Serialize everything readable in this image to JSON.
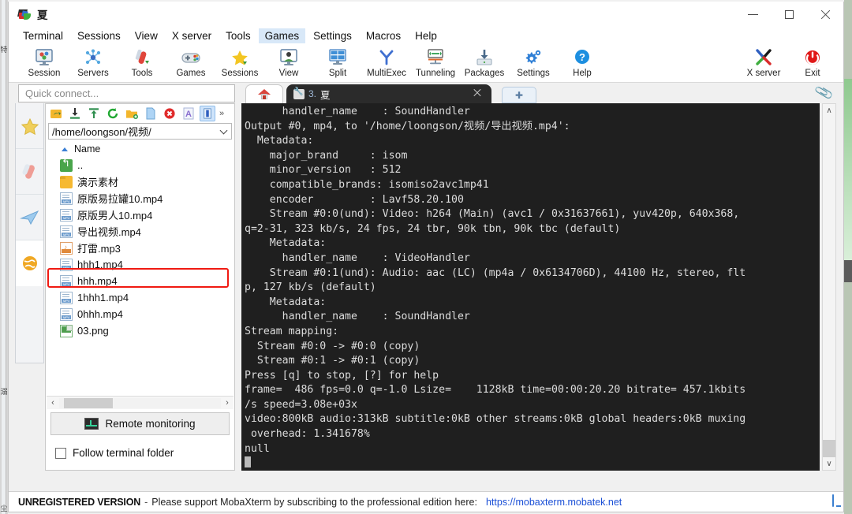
{
  "window": {
    "title": "夏",
    "app_icon": "mobaxterm-logo-icon",
    "minimize_label": "Minimize",
    "maximize_label": "Maximize",
    "close_label": "Close"
  },
  "menubar": {
    "items": [
      {
        "label": "Terminal",
        "active": false
      },
      {
        "label": "Sessions",
        "active": false
      },
      {
        "label": "View",
        "active": false
      },
      {
        "label": "X server",
        "active": false
      },
      {
        "label": "Tools",
        "active": false
      },
      {
        "label": "Games",
        "active": true
      },
      {
        "label": "Settings",
        "active": false
      },
      {
        "label": "Macros",
        "active": false
      },
      {
        "label": "Help",
        "active": false
      }
    ]
  },
  "toolbar": {
    "items": [
      {
        "label": "Session",
        "icon": "session-icon"
      },
      {
        "label": "Servers",
        "icon": "servers-icon"
      },
      {
        "label": "Tools",
        "icon": "tools-icon"
      },
      {
        "label": "Games",
        "icon": "games-gamepad-icon"
      },
      {
        "label": "Sessions",
        "icon": "star-icon"
      },
      {
        "label": "View",
        "icon": "view-monitor-icon"
      },
      {
        "label": "Split",
        "icon": "split-icon"
      },
      {
        "label": "MultiExec",
        "icon": "multiexec-icon"
      },
      {
        "label": "Tunneling",
        "icon": "tunneling-icon"
      },
      {
        "label": "Packages",
        "icon": "packages-download-icon"
      },
      {
        "label": "Settings",
        "icon": "gear-icon"
      },
      {
        "label": "Help",
        "icon": "help-question-icon"
      }
    ],
    "right_items": [
      {
        "label": "X server",
        "icon": "x-server-icon"
      },
      {
        "label": "Exit",
        "icon": "power-exit-icon"
      }
    ]
  },
  "quick_connect": {
    "placeholder": "Quick connect..."
  },
  "rail": {
    "items": [
      {
        "name": "sessions-star",
        "icon": "star-icon"
      },
      {
        "name": "tools",
        "icon": "swiss-knife-icon"
      },
      {
        "name": "macros",
        "icon": "paper-plane-icon"
      },
      {
        "name": "globe",
        "icon": "globe-icon"
      }
    ]
  },
  "file_browser": {
    "toolbar_icons": [
      {
        "name": "go-up-icon",
        "selected": false
      },
      {
        "name": "download-icon",
        "selected": false
      },
      {
        "name": "upload-icon",
        "selected": false
      },
      {
        "name": "refresh-icon",
        "selected": false
      },
      {
        "name": "new-folder-icon",
        "selected": false
      },
      {
        "name": "new-file-icon",
        "selected": false
      },
      {
        "name": "delete-icon",
        "selected": false
      },
      {
        "name": "text-mode-icon",
        "selected": false
      },
      {
        "name": "binary-mode-icon",
        "selected": true
      }
    ],
    "more_label": "»",
    "path": "/home/loongson/视频/",
    "column_header": "Name",
    "rows": [
      {
        "name": "..",
        "icon": "parent-dir-icon",
        "highlighted": false
      },
      {
        "name": "演示素材",
        "icon": "folder-icon",
        "highlighted": false
      },
      {
        "name": "原版易拉罐10.mp4",
        "icon": "mp4-file-icon",
        "highlighted": false
      },
      {
        "name": "原版男人10.mp4",
        "icon": "mp4-file-icon",
        "highlighted": false
      },
      {
        "name": "导出视频.mp4",
        "icon": "mp4-file-icon",
        "highlighted": true
      },
      {
        "name": "打雷.mp3",
        "icon": "mp3-file-icon",
        "highlighted": false
      },
      {
        "name": "hhh1.mp4",
        "icon": "mp4-file-icon",
        "highlighted": false
      },
      {
        "name": "hhh.mp4",
        "icon": "mp4-file-icon",
        "highlighted": false
      },
      {
        "name": "1hhh1.mp4",
        "icon": "mp4-file-icon",
        "highlighted": false
      },
      {
        "name": "0hhh.mp4",
        "icon": "mp4-file-icon",
        "highlighted": false
      },
      {
        "name": "03.png",
        "icon": "png-file-icon",
        "highlighted": false
      }
    ],
    "highlight_color": "#f01a12",
    "remote_monitoring_label": "Remote monitoring",
    "follow_terminal_folder_label": "Follow terminal folder",
    "follow_terminal_folder_checked": false,
    "scroll_left_label": "‹",
    "scroll_right_label": "›"
  },
  "tabs": {
    "home_tab": {
      "name": "home-tab",
      "icon": "home-icon"
    },
    "active_tab": {
      "icon": "wrench-icon",
      "number": "3.",
      "title": "夏",
      "close_label": "×"
    },
    "new_tab_label": "✚",
    "clip_icon": "paperclip-icon"
  },
  "terminal": {
    "text": "      handler_name    : SoundHandler\nOutput #0, mp4, to '/home/loongson/视频/导出视频.mp4':\n  Metadata:\n    major_brand     : isom\n    minor_version   : 512\n    compatible_brands: isomiso2avc1mp41\n    encoder         : Lavf58.20.100\n    Stream #0:0(und): Video: h264 (Main) (avc1 / 0x31637661), yuv420p, 640x368,\nq=2-31, 323 kb/s, 24 fps, 24 tbr, 90k tbn, 90k tbc (default)\n    Metadata:\n      handler_name    : VideoHandler\n    Stream #0:1(und): Audio: aac (LC) (mp4a / 0x6134706D), 44100 Hz, stereo, flt\np, 127 kb/s (default)\n    Metadata:\n      handler_name    : SoundHandler\nStream mapping:\n  Stream #0:0 -> #0:0 (copy)\n  Stream #0:1 -> #0:1 (copy)\nPress [q] to stop, [?] for help\nframe=  486 fps=0.0 q=-1.0 Lsize=    1128kB time=00:00:20.20 bitrate= 457.1kbits\n/s speed=3.08e+03x\nvideo:800kB audio:313kB subtitle:0kB other streams:0kB global headers:0kB muxing\n overhead: 1.341678%\nnull\n",
    "scroll_up_label": "∧",
    "scroll_down_label": "∨"
  },
  "statusbar": {
    "unregistered": "UNREGISTERED VERSION",
    "dash": "-",
    "message": "Please support MobaXterm by subscribing to the professional edition here:",
    "link": "https://mobaxterm.mobatek.net",
    "monitor_icon": "monitor-icon"
  },
  "desktop": {
    "left_glyphs": [
      "特",
      "溺",
      "尘"
    ]
  }
}
